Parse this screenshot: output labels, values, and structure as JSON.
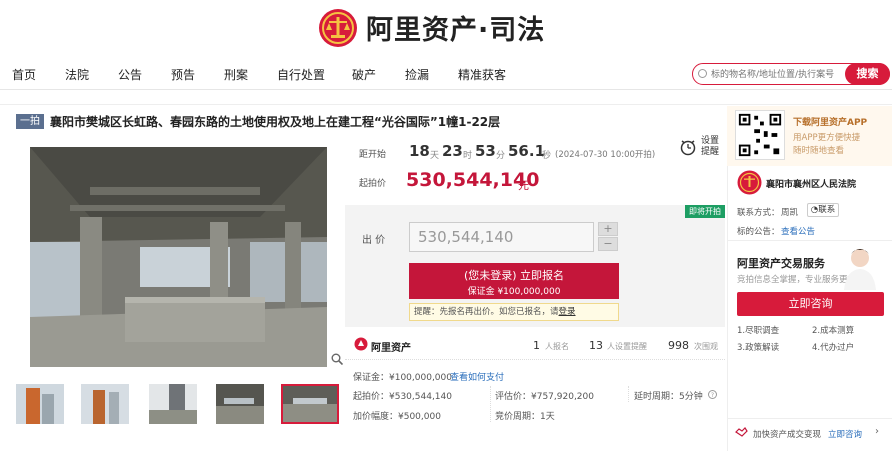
{
  "header": {
    "brand": "阿里资产·司法"
  },
  "nav": {
    "items": [
      "首页",
      "法院",
      "公告",
      "预告",
      "刑案",
      "自行处置",
      "破产",
      "捡漏",
      "精准获客"
    ]
  },
  "search": {
    "placeholder": "标的物名称/地址位置/执行案号",
    "button": "搜索"
  },
  "auction": {
    "tag": "一拍",
    "title": "襄阳市樊城区长虹路、春园东路的土地使用权及地上在建工程“光谷国际”1幢1-22层",
    "countdown_label": "距开始",
    "days": "18",
    "day_unit": "天",
    "hours": "23",
    "hour_unit": "时",
    "minutes": "53",
    "minute_unit": "分",
    "seconds": "56.1",
    "second_unit": "秒",
    "start_time": "(2024-07-30 10:00开拍)",
    "reminder": "设置提醒",
    "start_price_label": "起拍价",
    "start_price": "530,544,140",
    "price_unit": "元",
    "status_badge": "即将开拍",
    "bid_label": "出 价",
    "bid_value": "530,544,140",
    "plus": "+",
    "minus": "−",
    "register_title": "(您未登录) 立即报名",
    "register_sub": "保证金 ¥100,000,000",
    "tip_prefix": "提醒：先报名再出价。如您已报名，请",
    "tip_link": "登录",
    "platform": "阿里资产",
    "signups": "1",
    "signups_label": "人报名",
    "reminders": "13",
    "reminders_label": "人设置提醒",
    "views": "998",
    "views_label": "次围观"
  },
  "details": {
    "deposit": "保证金：¥100,000,000",
    "deposit_link": "查看如何支付",
    "start_price": "起拍价：¥530,544,140",
    "appraisal": "评估价：¥757,920,200",
    "delay": "延时周期：5分钟",
    "increment": "加价幅度：¥500,000",
    "bid_period": "竞价周期：1天"
  },
  "sidebar": {
    "promo_title": "下载阿里资产APP",
    "promo_sub1": "用APP更方便快捷",
    "promo_sub2": "随时随地查看",
    "court": "襄阳市襄州区人民法院",
    "contact_label": "联系方式：",
    "contact_name": "周凯",
    "contact_btn": "联系",
    "notice_label": "标的公告：",
    "notice_link": "查看公告",
    "service_title": "阿里资产交易服务",
    "service_sub": "竞拍信息全掌握，专业服务更放心",
    "consult": "立即咨询",
    "services": [
      "1.尽职调查",
      "2.成本测算",
      "3.政策解读",
      "4.代办过户"
    ],
    "footer": "加快资产成交变现",
    "footer_link": "立即咨询"
  },
  "colors": {
    "brand": "#d71b3b",
    "price": "#c4163a",
    "badge": "#1d9e63"
  }
}
